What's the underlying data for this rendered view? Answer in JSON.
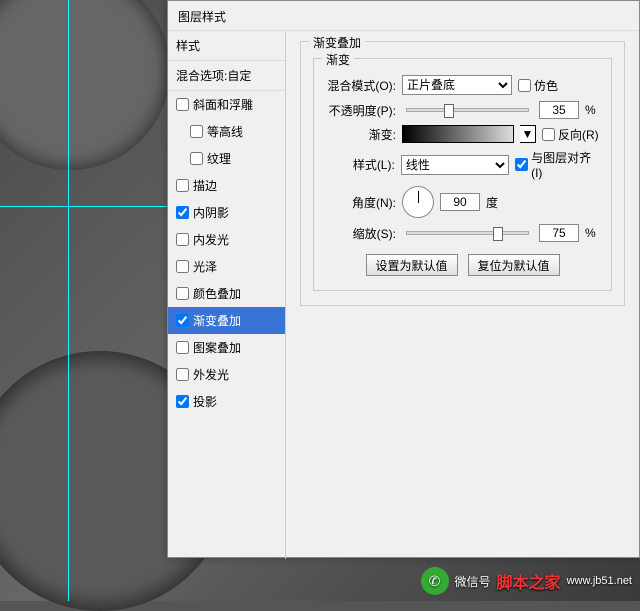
{
  "dialog": {
    "title": "图层样式"
  },
  "styles_panel": {
    "header": "样式",
    "blend_options": "混合选项:自定",
    "items": [
      {
        "label": "斜面和浮雕",
        "checked": false
      },
      {
        "label": "等高线",
        "checked": false,
        "indent": true
      },
      {
        "label": "纹理",
        "checked": false,
        "indent": true
      },
      {
        "label": "描边",
        "checked": false
      },
      {
        "label": "内阴影",
        "checked": true
      },
      {
        "label": "内发光",
        "checked": false
      },
      {
        "label": "光泽",
        "checked": false
      },
      {
        "label": "颜色叠加",
        "checked": false
      },
      {
        "label": "渐变叠加",
        "checked": true,
        "selected": true
      },
      {
        "label": "图案叠加",
        "checked": false
      },
      {
        "label": "外发光",
        "checked": false
      },
      {
        "label": "投影",
        "checked": true
      }
    ]
  },
  "gradient_overlay": {
    "group_title": "渐变叠加",
    "sub_title": "渐变",
    "blend_mode": {
      "label": "混合模式(O):",
      "value": "正片叠底"
    },
    "dither": {
      "label": "仿色"
    },
    "opacity": {
      "label": "不透明度(P):",
      "value": "35",
      "unit": "%",
      "pos": 35
    },
    "gradient": {
      "label": "渐变:"
    },
    "reverse": {
      "label": "反向(R)"
    },
    "style": {
      "label": "样式(L):",
      "value": "线性"
    },
    "align": {
      "label": "与图层对齐(I)"
    },
    "angle": {
      "label": "角度(N):",
      "value": "90",
      "unit": "度"
    },
    "scale": {
      "label": "缩放(S):",
      "value": "75",
      "unit": "%",
      "pos": 75
    },
    "btn_default": "设置为默认值",
    "btn_reset": "复位为默认值"
  },
  "watermark": {
    "wx": "微信号",
    "brand": "脚本之家",
    "url": "www.jb51.net"
  }
}
